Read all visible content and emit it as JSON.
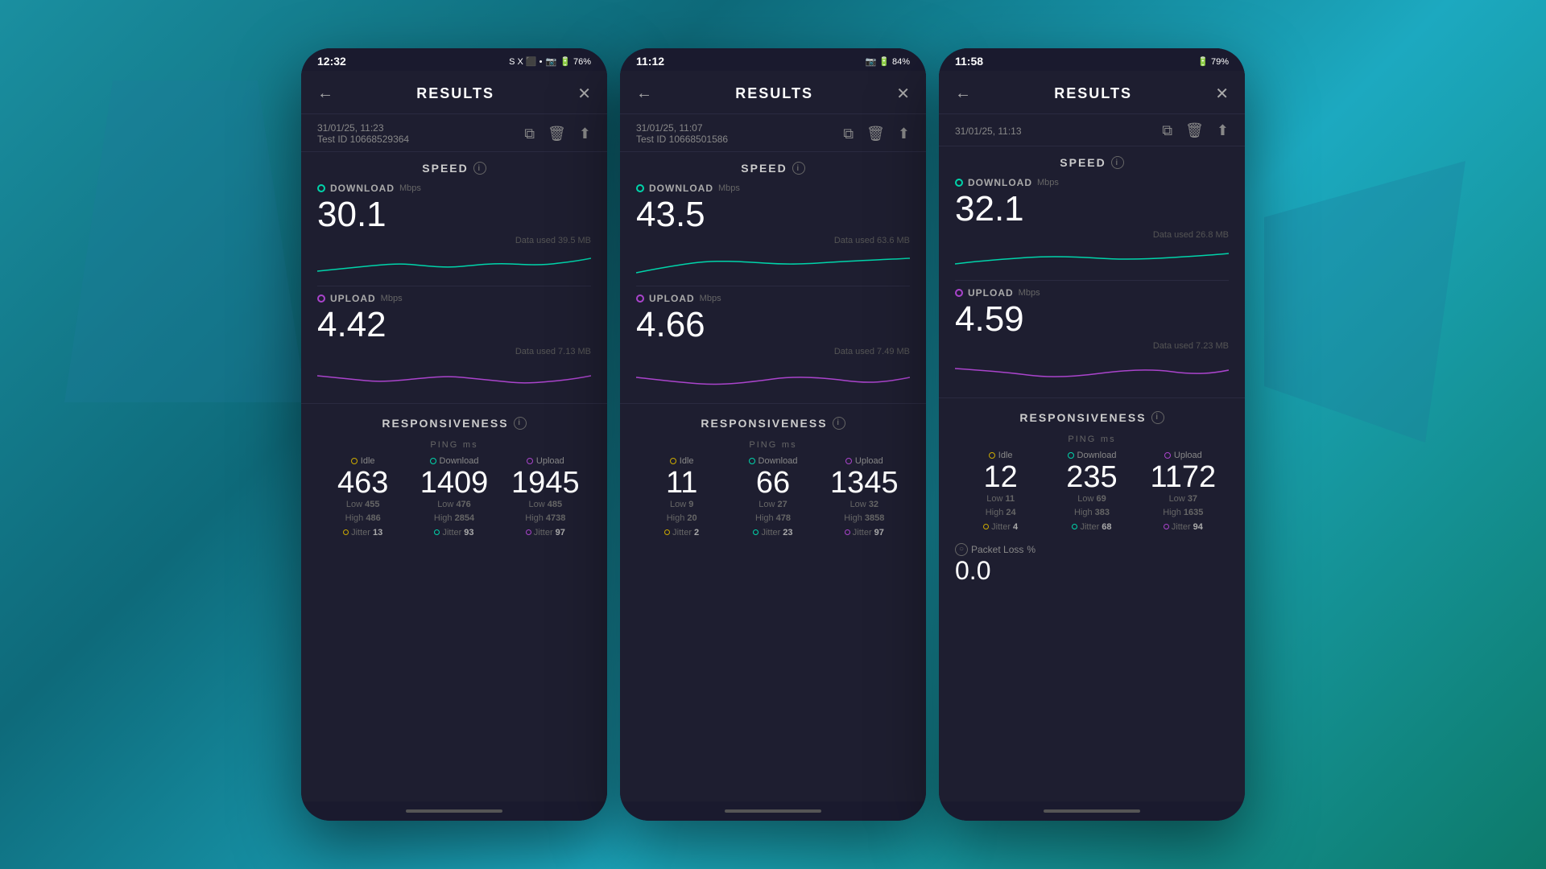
{
  "background": {
    "color": "#1a8fa0"
  },
  "phones": [
    {
      "id": "phone1",
      "status_bar": {
        "time": "12:32",
        "network": "S X ⬛",
        "icons_right": "📷 🔋 76%"
      },
      "header": {
        "title": "RESULTS",
        "back_label": "←",
        "close_label": "✕"
      },
      "test_info": {
        "date": "31/01/25, 11:23",
        "test_id": "Test ID 10668529364"
      },
      "speed": {
        "section_title": "SPEED",
        "download_label": "DOWNLOAD",
        "download_unit": "Mbps",
        "download_value": "30.1",
        "download_data": "Data used 39.5 MB",
        "upload_label": "UPLOAD",
        "upload_unit": "Mbps",
        "upload_value": "4.42",
        "upload_data": "Data used 7.13 MB"
      },
      "responsiveness": {
        "section_title": "RESPONSIVENESS",
        "ping_label": "PING",
        "ping_unit": "ms",
        "idle_label": "Idle",
        "idle_value": "463",
        "idle_low": "455",
        "idle_high": "486",
        "idle_jitter": "13",
        "download_label": "Download",
        "download_value": "1409",
        "download_low": "476",
        "download_high": "2854",
        "download_jitter": "93",
        "upload_label": "Upload",
        "upload_value": "1945",
        "upload_low": "485",
        "upload_high": "4738",
        "upload_jitter": "97"
      }
    },
    {
      "id": "phone2",
      "status_bar": {
        "time": "11:12",
        "icons_right": "📷 🔋 84%"
      },
      "header": {
        "title": "RESULTS",
        "back_label": "←",
        "close_label": "✕"
      },
      "test_info": {
        "date": "31/01/25, 11:07",
        "test_id": "Test ID 10668501586"
      },
      "speed": {
        "section_title": "SPEED",
        "download_label": "DOWNLOAD",
        "download_unit": "Mbps",
        "download_value": "43.5",
        "download_data": "Data used 63.6 MB",
        "upload_label": "UPLOAD",
        "upload_unit": "Mbps",
        "upload_value": "4.66",
        "upload_data": "Data used 7.49 MB"
      },
      "responsiveness": {
        "section_title": "RESPONSIVENESS",
        "ping_label": "PING",
        "ping_unit": "ms",
        "idle_label": "Idle",
        "idle_value": "11",
        "idle_low": "9",
        "idle_high": "20",
        "idle_jitter": "2",
        "download_label": "Download",
        "download_value": "66",
        "download_low": "27",
        "download_high": "478",
        "download_jitter": "23",
        "upload_label": "Upload",
        "upload_value": "1345",
        "upload_low": "32",
        "upload_high": "3858",
        "upload_jitter": "97"
      }
    },
    {
      "id": "phone3",
      "status_bar": {
        "time": "11:58",
        "icons_right": "🔋 79%"
      },
      "header": {
        "title": "RESULTS",
        "back_label": "←",
        "close_label": "✕"
      },
      "test_info": {
        "date": "31/01/25, 11:13",
        "test_id": ""
      },
      "speed": {
        "section_title": "SPEED",
        "download_label": "DOWNLOAD",
        "download_unit": "Mbps",
        "download_value": "32.1",
        "download_data": "Data used 26.8 MB",
        "upload_label": "UPLOAD",
        "upload_unit": "Mbps",
        "upload_value": "4.59",
        "upload_data": "Data used 7.23 MB"
      },
      "responsiveness": {
        "section_title": "RESPONSIVENESS",
        "ping_label": "PING",
        "ping_unit": "ms",
        "idle_label": "Idle",
        "idle_value": "12",
        "idle_low": "11",
        "idle_high": "24",
        "idle_jitter": "4",
        "download_label": "Download",
        "download_value": "235",
        "download_low": "69",
        "download_high": "383",
        "download_jitter": "68",
        "upload_label": "Upload",
        "upload_value": "1172",
        "upload_low": "37",
        "upload_high": "1635",
        "upload_jitter": "94"
      },
      "packet_loss": {
        "label": "Packet Loss",
        "unit": "%",
        "value": "0.0"
      }
    }
  ],
  "icons": {
    "back": "←",
    "close": "✕",
    "copy": "⧉",
    "delete": "🗑",
    "share": "↑"
  }
}
